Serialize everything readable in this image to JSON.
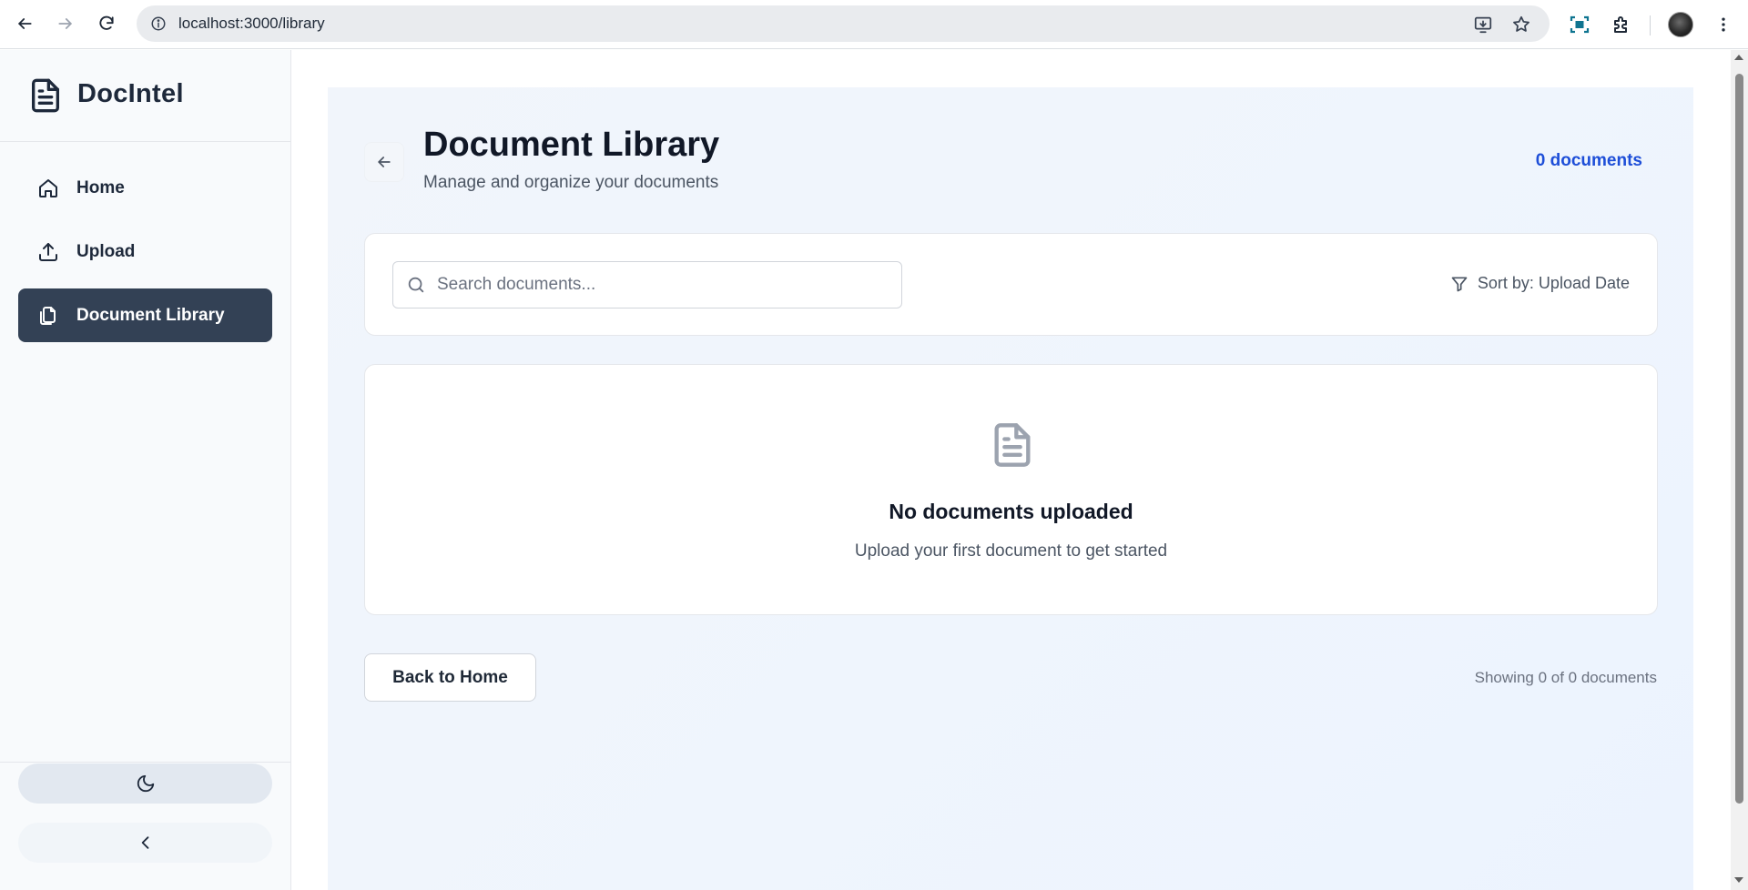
{
  "browser": {
    "url": "localhost:3000/library",
    "icons": [
      "back-arrow-icon",
      "forward-arrow-icon",
      "reload-icon",
      "site-info-icon",
      "install-app-icon",
      "bookmark-star-icon",
      "screenshot-icon",
      "extensions-icon",
      "profile-avatar",
      "menu-kebab-icon"
    ]
  },
  "sidebar": {
    "brand": "DocIntel",
    "items": [
      {
        "label": "Home",
        "icon": "home-icon",
        "active": false
      },
      {
        "label": "Upload",
        "icon": "upload-icon",
        "active": false
      },
      {
        "label": "Document Library",
        "icon": "documents-icon",
        "active": true
      }
    ],
    "theme_toggle_icon": "moon-icon",
    "collapse_icon": "chevron-left-icon"
  },
  "header": {
    "title": "Document Library",
    "subtitle": "Manage and organize your documents",
    "count": "0 documents"
  },
  "search": {
    "placeholder": "Search documents...",
    "value": "",
    "sort_label": "Sort by: Upload Date"
  },
  "empty_state": {
    "title": "No documents uploaded",
    "subtitle": "Upload your first document to get started"
  },
  "footer": {
    "back_button": "Back to Home",
    "showing": "Showing 0 of 0 documents"
  },
  "colors": {
    "accent": "#1d4ed8",
    "sidebar_active": "#334155",
    "sidebar_bg": "#f8fafc"
  }
}
